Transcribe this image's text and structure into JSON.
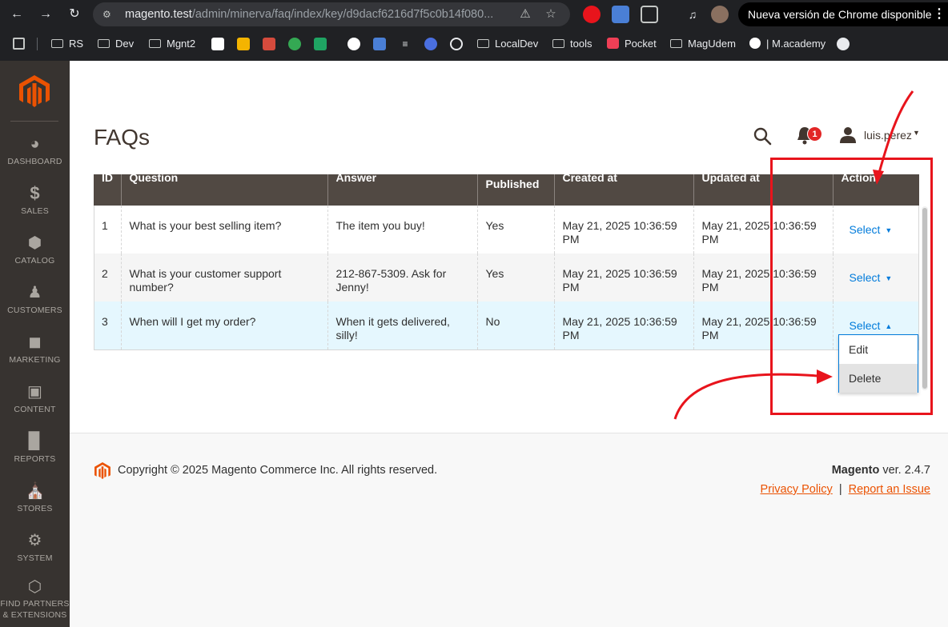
{
  "browser": {
    "url_host": "magento.test",
    "url_path": "/admin/minerva/faq/index/key/d9dacf6216d7f5c0b14f080...",
    "update_notice": "Nueva versión de Chrome disponible",
    "bookmarks": [
      "RS",
      "Dev",
      "Mgnt2",
      "LocalDev",
      "tools",
      "Pocket",
      "MagUdem",
      "| M.academy"
    ]
  },
  "sidebar": {
    "items": [
      {
        "label": "DASHBOARD",
        "icon": "dashboard-icon"
      },
      {
        "label": "SALES",
        "icon": "dollar-icon"
      },
      {
        "label": "CATALOG",
        "icon": "box-icon"
      },
      {
        "label": "CUSTOMERS",
        "icon": "person-icon"
      },
      {
        "label": "MARKETING",
        "icon": "megaphone-icon"
      },
      {
        "label": "CONTENT",
        "icon": "layout-icon"
      },
      {
        "label": "REPORTS",
        "icon": "bar-chart-icon"
      },
      {
        "label": "STORES",
        "icon": "store-icon"
      },
      {
        "label": "SYSTEM",
        "icon": "gear-icon"
      },
      {
        "label": "FIND PARTNERS & EXTENSIONS",
        "label_line1": "FIND PARTNERS",
        "label_line2": "& EXTENSIONS",
        "icon": "extensions-icon"
      }
    ]
  },
  "header": {
    "title": "FAQs",
    "notification_count": "1",
    "username": "luis.perez"
  },
  "grid": {
    "columns": [
      "ID",
      "Question",
      "Answer",
      "Is Published",
      "Created at",
      "Updated at",
      "Action"
    ],
    "is_published_visible": "Published",
    "rows": [
      {
        "id": "1",
        "question": "What is your best selling item?",
        "answer": "The item you buy!",
        "published": "Yes",
        "created": "May 21, 2025 10:36:59 PM",
        "updated": "May 21, 2025 10:36:59 PM",
        "action": "Select"
      },
      {
        "id": "2",
        "question": "What is your customer support number?",
        "answer": "212-867-5309. Ask for Jenny!",
        "published": "Yes",
        "created": "May 21, 2025 10:36:59 PM",
        "updated": "May 21, 2025 10:36:59 PM",
        "action": "Select"
      },
      {
        "id": "3",
        "question": "When will I get my order?",
        "answer": "When it gets delivered, silly!",
        "published": "No",
        "created": "May 21, 2025 10:36:59 PM",
        "updated": "May 21, 2025 10:36:59 PM",
        "action": "Select"
      }
    ],
    "action_menu": [
      "Edit",
      "Delete"
    ]
  },
  "footer": {
    "copyright": "Copyright © 2025 Magento Commerce Inc. All rights reserved.",
    "brand": "Magento",
    "version": " ver. 2.4.7",
    "privacy": "Privacy Policy",
    "separator": "|",
    "report": "Report an Issue"
  },
  "colors": {
    "sidebar_bg": "#373330",
    "header_row": "#514943",
    "accent_orange": "#eb5202",
    "link_blue": "#007bdb",
    "annotation_red": "#e8141c"
  }
}
